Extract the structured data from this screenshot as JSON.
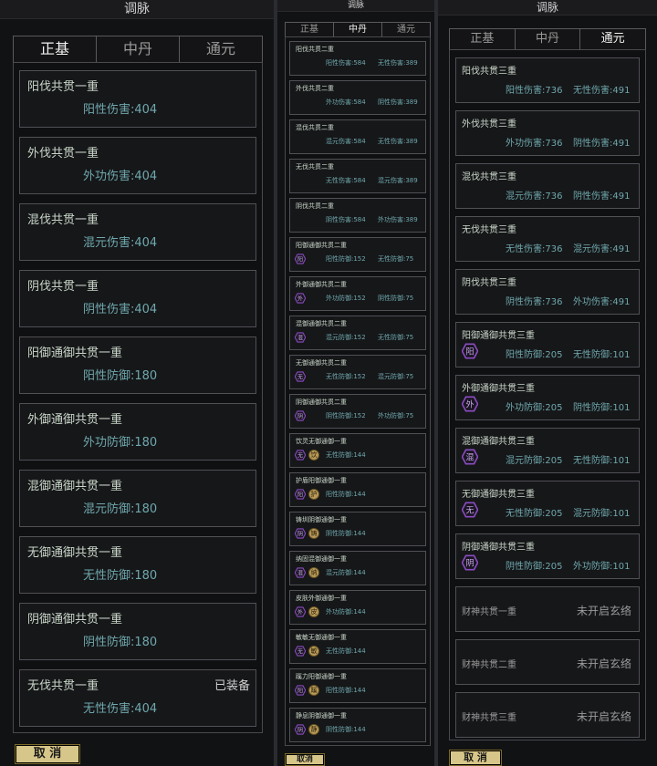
{
  "panel1": {
    "title": "调脉",
    "tabs": [
      "正基",
      "中丹",
      "通元"
    ],
    "active_tab": 0,
    "cards": [
      {
        "title": "阳伐共贯一重",
        "stat": "阳性伤害:404"
      },
      {
        "title": "外伐共贯一重",
        "stat": "外功伤害:404"
      },
      {
        "title": "混伐共贯一重",
        "stat": "混元伤害:404"
      },
      {
        "title": "阴伐共贯一重",
        "stat": "阴性伤害:404"
      },
      {
        "title": "阳御通御共贯一重",
        "stat": "阳性防御:180"
      },
      {
        "title": "外御通御共贯一重",
        "stat": "外功防御:180"
      },
      {
        "title": "混御通御共贯一重",
        "stat": "混元防御:180"
      },
      {
        "title": "无御通御共贯一重",
        "stat": "无性防御:180"
      },
      {
        "title": "阴御通御共贯一重",
        "stat": "阴性防御:180"
      },
      {
        "title": "无伐共贯一重",
        "stat": "无性伤害:404",
        "badge": "已装备"
      }
    ],
    "cancel": "取 消"
  },
  "panel2": {
    "title": "调脉",
    "tabs": [
      "正基",
      "中丹",
      "通元"
    ],
    "active_tab": 1,
    "cards": [
      {
        "title": "阳伐共贯二重",
        "stat1": "阳性伤害:584",
        "stat2": "无性伤害:389"
      },
      {
        "title": "外伐共贯二重",
        "stat1": "外功伤害:584",
        "stat2": "阴性伤害:389"
      },
      {
        "title": "混伐共贯二重",
        "stat1": "混元伤害:584",
        "stat2": "无性伤害:389"
      },
      {
        "title": "无伐共贯二重",
        "stat1": "无性伤害:584",
        "stat2": "混元伤害:389"
      },
      {
        "title": "阴伐共贯二重",
        "stat1": "阴性伤害:584",
        "stat2": "外功伤害:389"
      },
      {
        "title": "阳御通御共贯二重",
        "stat1": "阳性防御:152",
        "stat2": "无性防御:75",
        "icon": "阳"
      },
      {
        "title": "外御通御共贯二重",
        "stat1": "外功防御:152",
        "stat2": "阴性防御:75",
        "icon": "外"
      },
      {
        "title": "混御通御共贯二重",
        "stat1": "混元防御:152",
        "stat2": "无性防御:75",
        "icon": "混"
      },
      {
        "title": "无御通御共贯二重",
        "stat1": "无性防御:152",
        "stat2": "混元防御:75",
        "icon": "无"
      },
      {
        "title": "阴御通御共贯二重",
        "stat1": "阴性防御:152",
        "stat2": "外功防御:75",
        "icon": "阴"
      },
      {
        "title": "饮灵无御通御一重",
        "stat1": "无性防御:144",
        "icon": "无",
        "gem": "饮"
      },
      {
        "title": "护盾阳御通御一重",
        "stat1": "阳性防御:144",
        "icon": "阳",
        "gem": "护"
      },
      {
        "title": "铸圳阴御通御一重",
        "stat1": "阴性防御:144",
        "icon": "阴",
        "gem": "铸"
      },
      {
        "title": "纳固混御通御一重",
        "stat1": "混元防御:144",
        "icon": "混",
        "gem": "纳"
      },
      {
        "title": "皮肤外御通御一重",
        "stat1": "外功防御:144",
        "icon": "外",
        "gem": "皮"
      },
      {
        "title": "敏敏无御通御一重",
        "stat1": "无性防御:144",
        "icon": "无",
        "gem": "敏"
      },
      {
        "title": "蹊力阳御通御一重",
        "stat1": "阳性防御:144",
        "icon": "阳",
        "gem": "蹊"
      },
      {
        "title": "静息阴御通御一重",
        "stat1": "阴性防御:144",
        "icon": "阴",
        "gem": "静"
      }
    ],
    "cancel": "取消"
  },
  "panel3": {
    "title": "调脉",
    "tabs": [
      "正基",
      "中丹",
      "通元"
    ],
    "active_tab": 2,
    "cards": [
      {
        "title": "阳伐共贯三重",
        "stat1": "阳性伤害:736",
        "stat2": "无性伤害:491"
      },
      {
        "title": "外伐共贯三重",
        "stat1": "外功伤害:736",
        "stat2": "阴性伤害:491"
      },
      {
        "title": "混伐共贯三重",
        "stat1": "混元伤害:736",
        "stat2": "阴性伤害:491"
      },
      {
        "title": "无伐共贯三重",
        "stat1": "无性伤害:736",
        "stat2": "混元伤害:491"
      },
      {
        "title": "阴伐共贯三重",
        "stat1": "阴性伤害:736",
        "stat2": "外功伤害:491"
      },
      {
        "title": "阳御通御共贯三重",
        "stat1": "阳性防御:205",
        "stat2": "无性防御:101",
        "icon": "阳"
      },
      {
        "title": "外御通御共贯三重",
        "stat1": "外功防御:205",
        "stat2": "阴性防御:101",
        "icon": "外"
      },
      {
        "title": "混御通御共贯三重",
        "stat1": "混元防御:205",
        "stat2": "无性防御:101",
        "icon": "混"
      },
      {
        "title": "无御通御共贯三重",
        "stat1": "无性防御:205",
        "stat2": "混元防御:101",
        "icon": "无"
      },
      {
        "title": "阴御通御共贯三重",
        "stat1": "阴性防御:205",
        "stat2": "外功防御:101",
        "icon": "阴"
      },
      {
        "title": "财神共贯一重",
        "status": "未开启玄络"
      },
      {
        "title": "财神共贯二重",
        "status": "未开启玄络"
      },
      {
        "title": "财神共贯三重",
        "status": "未开启玄络"
      }
    ],
    "cancel": "取 消"
  },
  "colors": {
    "accent_text": "#6fa8ad",
    "title_text": "#c9d6c9",
    "button": "#d7c689",
    "hex_icon": "#8a4cc0",
    "gem": "#b89a5a"
  }
}
